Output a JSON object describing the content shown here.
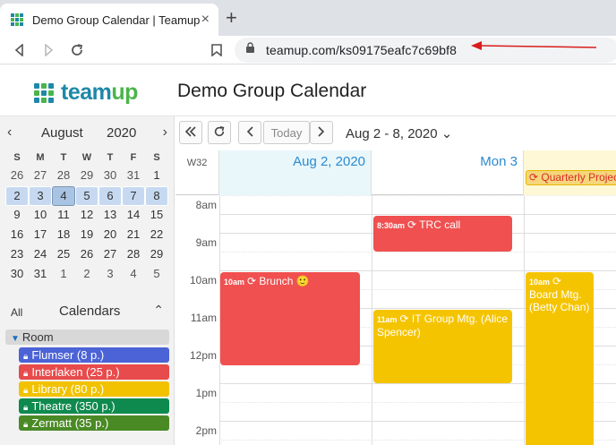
{
  "browser": {
    "tab_title": "Demo Group Calendar | Teamup",
    "tab_close": "×",
    "new_tab": "+",
    "url": "teamup.com/ks09175eafc7c69bf8"
  },
  "app": {
    "logo_text_a": "team",
    "logo_text_b": "up",
    "title": "Demo Group Calendar"
  },
  "mini_calendar": {
    "prev": "‹",
    "next": "›",
    "month": "August",
    "year": "2020",
    "dow": [
      "S",
      "M",
      "T",
      "W",
      "T",
      "F",
      "S"
    ],
    "weeks": [
      [
        "26",
        "27",
        "28",
        "29",
        "30",
        "31",
        "1"
      ],
      [
        "2",
        "3",
        "4",
        "5",
        "6",
        "7",
        "8"
      ],
      [
        "9",
        "10",
        "11",
        "12",
        "13",
        "14",
        "15"
      ],
      [
        "16",
        "17",
        "18",
        "19",
        "20",
        "21",
        "22"
      ],
      [
        "23",
        "24",
        "25",
        "26",
        "27",
        "28",
        "29"
      ],
      [
        "30",
        "31",
        "1",
        "2",
        "3",
        "4",
        "5"
      ]
    ]
  },
  "calendars": {
    "all_label": "All",
    "heading": "Calendars",
    "collapse": "⌃",
    "folder": "Room",
    "items": [
      {
        "label": "Flumser (8 p.)",
        "color": "#4b63d6"
      },
      {
        "label": "Interlaken (25 p.)",
        "color": "#e84b4b"
      },
      {
        "label": "Library (80 p.)",
        "color": "#f2c200"
      },
      {
        "label": "Theatre (350 p.)",
        "color": "#0f8a4e"
      },
      {
        "label": "Zermatt (35 p.)",
        "color": "#4a8a25"
      }
    ]
  },
  "toolbar": {
    "today": "Today",
    "range": "Aug 2 - 8, 2020 ⌄"
  },
  "grid": {
    "week_label": "W32",
    "days": [
      "Aug 2, 2020",
      "Mon 3"
    ],
    "times": [
      "8am",
      "9am",
      "10am",
      "11am",
      "12pm",
      "1pm",
      "2pm"
    ],
    "allday_event": "Quarterly Projec"
  },
  "events": [
    {
      "time": "8:30am",
      "title": "TRC call",
      "color": "#f05050"
    },
    {
      "time": "10am",
      "title": "Brunch 🙂",
      "color": "#f05050"
    },
    {
      "time": "11am",
      "title": "IT Group Mtg. (Alice Spencer)",
      "color": "#f5c400"
    },
    {
      "time": "10am",
      "title": "Board Mtg. (Betty Chan)",
      "color": "#f5c400"
    }
  ],
  "colors": {
    "accent_blue": "#2b8ad0",
    "brand_blue": "#1e88a8",
    "brand_green": "#4ab54a"
  }
}
